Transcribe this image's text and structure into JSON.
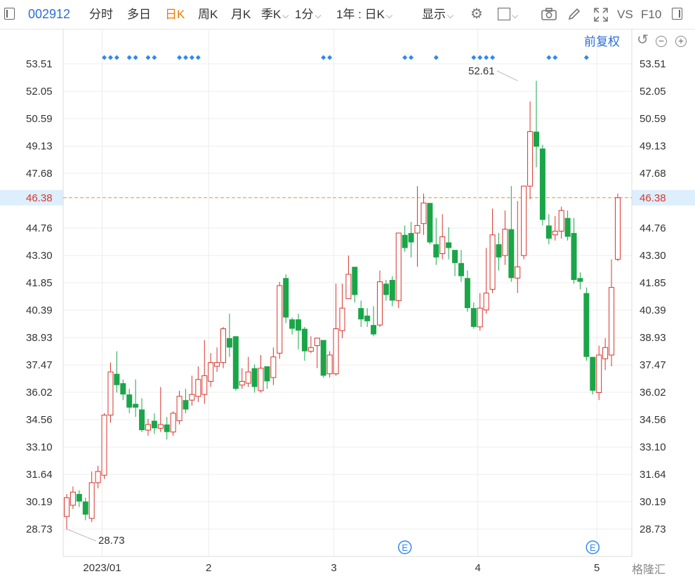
{
  "toolbar": {
    "stock_code": "002912",
    "tabs": [
      {
        "label": "分时"
      },
      {
        "label": "多日"
      },
      {
        "label": "日K",
        "active": true
      },
      {
        "label": "周K"
      },
      {
        "label": "月K"
      },
      {
        "label": "季K"
      },
      {
        "label": "1分"
      }
    ],
    "range_select": "1年 : 日K",
    "display_label": "显示",
    "vs_label": "VS",
    "f10_label": "F10"
  },
  "subheader": {
    "adjust_label": "前复权"
  },
  "watermark": "格隆汇",
  "colors": {
    "up": "#d9342b",
    "down": "#1aa648",
    "current_line": "#f0901e",
    "current_label_bg": "#ddeefc",
    "current_label_text": "#d9342b",
    "marker": "#2a8bf0"
  },
  "chart_data": {
    "type": "candlestick",
    "ylim": [
      27.6,
      54.8
    ],
    "y_ticks": [
      "53.51",
      "52.05",
      "50.59",
      "49.13",
      "47.68",
      "46.38",
      "44.76",
      "43.30",
      "41.85",
      "40.39",
      "38.93",
      "37.47",
      "36.02",
      "34.56",
      "33.10",
      "31.64",
      "30.19",
      "28.73"
    ],
    "current_price": "46.38",
    "x_ticks": [
      {
        "label": "2023/01",
        "index": 6
      },
      {
        "label": "2",
        "index": 23
      },
      {
        "label": "3",
        "index": 43
      },
      {
        "label": "4",
        "index": 66
      },
      {
        "label": "5",
        "index": 85
      }
    ],
    "annotations": [
      {
        "label": "52.61",
        "index": 72,
        "value": 52.61
      },
      {
        "label": "28.73",
        "index": 0,
        "value": 28.73
      }
    ],
    "event_markers": [
      {
        "label": "E",
        "index": 54
      },
      {
        "label": "E",
        "index": 84
      }
    ],
    "marker_index": [
      6,
      7,
      8,
      10,
      11,
      13,
      14,
      18,
      19,
      20,
      21,
      41,
      42,
      54,
      55,
      59,
      65,
      66,
      67,
      68,
      77,
      78,
      83
    ],
    "candles": [
      [
        29.4,
        30.4,
        30.6,
        28.7
      ],
      [
        30.0,
        30.7,
        31.0,
        29.8
      ],
      [
        30.6,
        30.2,
        30.8,
        29.9
      ],
      [
        30.2,
        29.5,
        30.4,
        29.2
      ],
      [
        29.3,
        31.2,
        31.8,
        29.1
      ],
      [
        31.2,
        31.8,
        32.1,
        30.9
      ],
      [
        31.6,
        34.8,
        34.9,
        31.4
      ],
      [
        34.8,
        37.1,
        37.6,
        34.4
      ],
      [
        37.0,
        36.4,
        38.2,
        36.0
      ],
      [
        36.5,
        35.9,
        36.7,
        35.6
      ],
      [
        35.9,
        35.2,
        36.2,
        34.9
      ],
      [
        35.4,
        35.2,
        36.7,
        34.7
      ],
      [
        35.1,
        34.0,
        35.7,
        33.9
      ],
      [
        34.0,
        34.3,
        34.6,
        33.7
      ],
      [
        34.5,
        34.1,
        34.9,
        33.8
      ],
      [
        34.1,
        34.3,
        36.3,
        33.9
      ],
      [
        34.3,
        33.9,
        34.7,
        33.5
      ],
      [
        33.9,
        34.9,
        35.0,
        33.7
      ],
      [
        34.5,
        35.8,
        36.1,
        34.3
      ],
      [
        35.6,
        35.1,
        36.2,
        34.9
      ],
      [
        35.6,
        35.9,
        36.9,
        35.3
      ],
      [
        35.8,
        36.7,
        37.4,
        35.5
      ],
      [
        35.9,
        36.9,
        38.8,
        35.4
      ],
      [
        36.6,
        37.6,
        38.1,
        36.3
      ],
      [
        37.4,
        37.6,
        38.4,
        37.1
      ],
      [
        37.6,
        39.4,
        39.5,
        37.3
      ],
      [
        38.9,
        38.4,
        40.2,
        37.9
      ],
      [
        39.0,
        36.2,
        39.0,
        36.1
      ],
      [
        36.4,
        36.6,
        37.3,
        36.2
      ],
      [
        36.5,
        37.1,
        37.9,
        36.3
      ],
      [
        37.3,
        36.3,
        37.5,
        36.0
      ],
      [
        36.1,
        37.3,
        38.0,
        36.0
      ],
      [
        37.4,
        36.6,
        37.4,
        36.2
      ],
      [
        36.8,
        37.9,
        38.4,
        36.4
      ],
      [
        38.1,
        41.7,
        41.9,
        37.8
      ],
      [
        42.1,
        40.0,
        42.3,
        39.7
      ],
      [
        39.9,
        39.4,
        40.0,
        39.1
      ],
      [
        39.9,
        39.3,
        40.2,
        38.3
      ],
      [
        39.4,
        38.2,
        39.5,
        37.7
      ],
      [
        38.2,
        38.4,
        39.0,
        38.1
      ],
      [
        38.5,
        38.9,
        38.9,
        37.3
      ],
      [
        38.8,
        36.9,
        38.8,
        36.8
      ],
      [
        37.0,
        38.0,
        38.2,
        36.8
      ],
      [
        37.0,
        39.4,
        41.8,
        36.9
      ],
      [
        39.3,
        40.5,
        41.8,
        38.9
      ],
      [
        41.0,
        42.3,
        43.3,
        41.0
      ],
      [
        42.7,
        41.2,
        42.7,
        40.8
      ],
      [
        40.5,
        39.9,
        40.9,
        39.5
      ],
      [
        40.1,
        39.8,
        40.5,
        39.5
      ],
      [
        39.6,
        39.1,
        40.6,
        39.0
      ],
      [
        39.6,
        41.9,
        42.5,
        39.5
      ],
      [
        41.8,
        41.2,
        42.0,
        40.9
      ],
      [
        42.0,
        40.9,
        42.2,
        40.6
      ],
      [
        40.9,
        44.5,
        44.5,
        40.5
      ],
      [
        44.4,
        43.7,
        44.9,
        43.5
      ],
      [
        44.5,
        44.0,
        45.1,
        43.2
      ],
      [
        44.5,
        44.9,
        47.0,
        42.7
      ],
      [
        45.0,
        46.1,
        46.6,
        44.4
      ],
      [
        46.1,
        44.0,
        46.1,
        43.9
      ],
      [
        43.9,
        43.2,
        45.3,
        42.8
      ],
      [
        43.4,
        44.3,
        45.5,
        43.1
      ],
      [
        44.0,
        43.7,
        44.8,
        43.1
      ],
      [
        43.6,
        42.9,
        43.6,
        42.2
      ],
      [
        42.9,
        42.2,
        43.6,
        41.9
      ],
      [
        42.1,
        40.5,
        42.5,
        40.3
      ],
      [
        40.5,
        39.5,
        40.8,
        39.4
      ],
      [
        39.5,
        40.5,
        41.3,
        39.3
      ],
      [
        40.4,
        41.3,
        43.7,
        40.2
      ],
      [
        41.5,
        44.4,
        45.8,
        41.3
      ],
      [
        43.9,
        43.2,
        44.5,
        42.5
      ],
      [
        43.3,
        44.7,
        45.7,
        42.8
      ],
      [
        44.7,
        42.1,
        47.0,
        41.9
      ],
      [
        42.1,
        42.7,
        46.2,
        41.3
      ],
      [
        43.3,
        47.0,
        47.0,
        43.1
      ],
      [
        47.0,
        49.9,
        51.5,
        46.3
      ],
      [
        49.9,
        49.1,
        52.61,
        48.0
      ],
      [
        49.0,
        45.2,
        49.2,
        44.9
      ],
      [
        44.9,
        44.2,
        45.5,
        43.9
      ],
      [
        44.4,
        44.6,
        45.4,
        44.1
      ],
      [
        44.6,
        45.7,
        45.9,
        44.2
      ],
      [
        45.3,
        44.3,
        45.7,
        44.1
      ],
      [
        44.5,
        42.0,
        45.3,
        41.8
      ],
      [
        42.1,
        41.9,
        42.4,
        41.5
      ],
      [
        41.3,
        37.9,
        41.6,
        37.7
      ],
      [
        37.9,
        36.1,
        37.9,
        35.9
      ],
      [
        36.0,
        38.0,
        38.5,
        35.6
      ],
      [
        37.8,
        38.4,
        38.9,
        37.2
      ],
      [
        38.0,
        41.6,
        43.1,
        37.4
      ],
      [
        43.1,
        46.38,
        46.6,
        43.0
      ]
    ]
  }
}
